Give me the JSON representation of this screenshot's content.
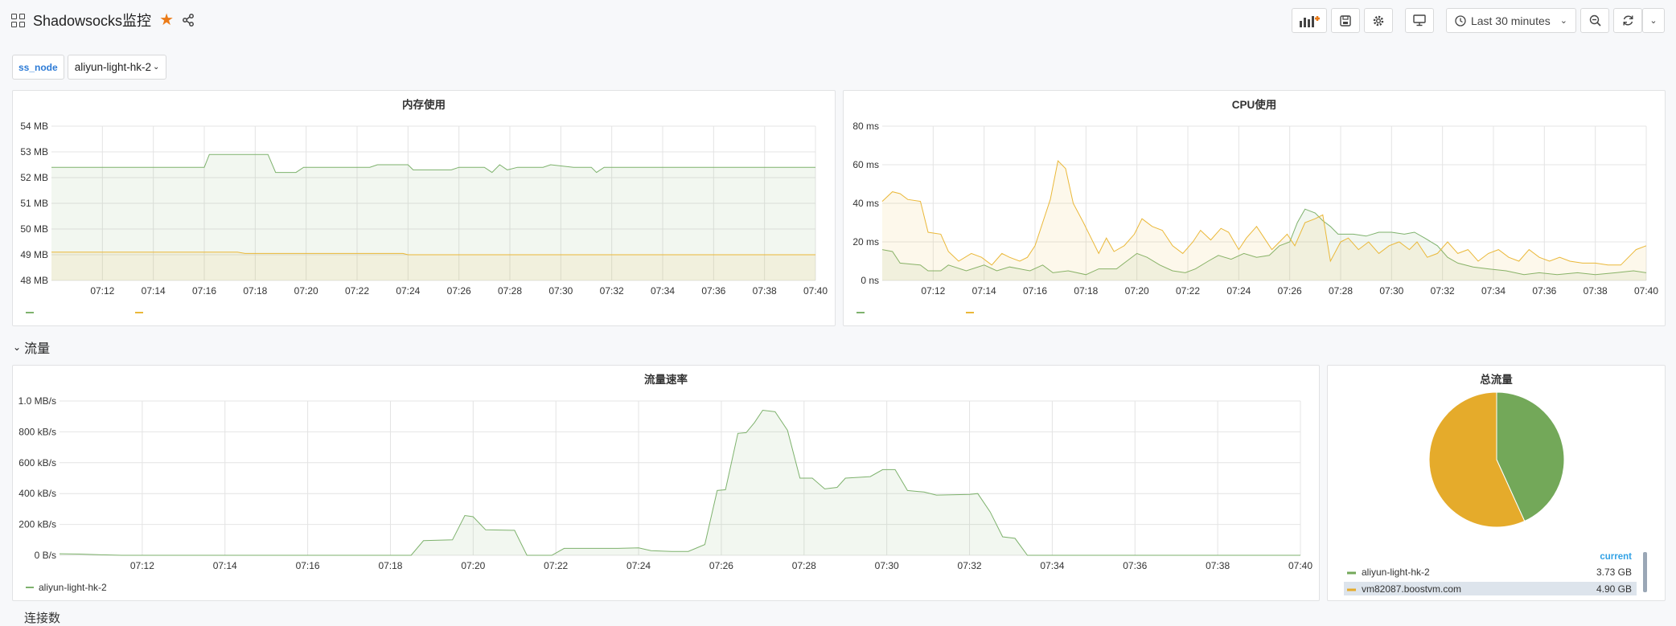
{
  "header": {
    "title": "Shadowsocks监控",
    "time_range": "Last 30 minutes"
  },
  "variables": {
    "label": "ss_node",
    "value": "aliyun-light-hk-2"
  },
  "colors": {
    "green": "#7eb26d",
    "yellow": "#eab839",
    "pie_green": "#73a859",
    "pie_yellow": "#e5ab2b"
  },
  "panels": {
    "memory": {
      "title": "内存使用"
    },
    "cpu": {
      "title": "CPU使用"
    },
    "rate": {
      "title": "流量速率"
    },
    "total": {
      "title": "总流量",
      "current_header": "current"
    }
  },
  "rows": {
    "traffic": "流量",
    "connections": "连接数"
  },
  "chart_data": [
    {
      "type": "area",
      "name": "memory",
      "title": "内存使用",
      "ylim": [
        48,
        54
      ],
      "y_ticks": [
        "48 MB",
        "49 MB",
        "50 MB",
        "51 MB",
        "52 MB",
        "53 MB",
        "54 MB"
      ],
      "x_ticks": [
        "07:12",
        "07:14",
        "07:16",
        "07:18",
        "07:20",
        "07:22",
        "07:24",
        "07:26",
        "07:28",
        "07:30",
        "07:32",
        "07:34",
        "07:36",
        "07:38",
        "07:40"
      ],
      "x_range": [
        10.0,
        40.0
      ],
      "series": [
        {
          "color": "#7eb26d",
          "points": [
            [
              10.0,
              52.4
            ],
            [
              16.0,
              52.4
            ],
            [
              16.2,
              52.9
            ],
            [
              18.5,
              52.9
            ],
            [
              18.8,
              52.2
            ],
            [
              19.6,
              52.2
            ],
            [
              19.9,
              52.4
            ],
            [
              22.5,
              52.4
            ],
            [
              22.8,
              52.5
            ],
            [
              24.0,
              52.5
            ],
            [
              24.2,
              52.3
            ],
            [
              25.7,
              52.3
            ],
            [
              26.0,
              52.4
            ],
            [
              27.0,
              52.4
            ],
            [
              27.3,
              52.2
            ],
            [
              27.6,
              52.5
            ],
            [
              27.9,
              52.3
            ],
            [
              28.3,
              52.4
            ],
            [
              29.3,
              52.4
            ],
            [
              29.6,
              52.5
            ],
            [
              30.5,
              52.4
            ],
            [
              31.2,
              52.4
            ],
            [
              31.4,
              52.2
            ],
            [
              31.7,
              52.4
            ],
            [
              40.0,
              52.4
            ]
          ]
        },
        {
          "color": "#eab839",
          "points": [
            [
              10.0,
              49.1
            ],
            [
              17.3,
              49.1
            ],
            [
              17.6,
              49.05
            ],
            [
              23.8,
              49.05
            ],
            [
              24.0,
              49.0
            ],
            [
              40.0,
              49.0
            ]
          ]
        }
      ]
    },
    {
      "type": "area",
      "name": "cpu",
      "title": "CPU使用",
      "ylim": [
        0,
        80
      ],
      "y_ticks": [
        "0 ns",
        "20 ms",
        "40 ms",
        "60 ms",
        "80 ms"
      ],
      "x_ticks": [
        "07:12",
        "07:14",
        "07:16",
        "07:18",
        "07:20",
        "07:22",
        "07:24",
        "07:26",
        "07:28",
        "07:30",
        "07:32",
        "07:34",
        "07:36",
        "07:38",
        "07:40"
      ],
      "x_range": [
        10.0,
        40.0
      ],
      "series": [
        {
          "color": "#7eb26d",
          "points": [
            [
              10.0,
              16
            ],
            [
              10.4,
              15
            ],
            [
              10.7,
              9
            ],
            [
              11.5,
              8
            ],
            [
              11.8,
              5
            ],
            [
              12.3,
              5
            ],
            [
              12.6,
              8
            ],
            [
              13.3,
              5
            ],
            [
              14.0,
              8
            ],
            [
              14.5,
              5
            ],
            [
              15.0,
              7
            ],
            [
              15.8,
              5
            ],
            [
              16.3,
              8
            ],
            [
              16.7,
              4
            ],
            [
              17.3,
              5
            ],
            [
              18.0,
              3
            ],
            [
              18.5,
              6
            ],
            [
              19.2,
              6
            ],
            [
              19.6,
              10
            ],
            [
              20.0,
              14
            ],
            [
              20.4,
              12
            ],
            [
              20.9,
              8
            ],
            [
              21.4,
              5
            ],
            [
              21.9,
              4
            ],
            [
              22.3,
              6
            ],
            [
              22.8,
              10
            ],
            [
              23.2,
              13
            ],
            [
              23.7,
              11
            ],
            [
              24.2,
              14
            ],
            [
              24.7,
              12
            ],
            [
              25.2,
              13
            ],
            [
              25.6,
              18
            ],
            [
              26.0,
              20
            ],
            [
              26.3,
              30
            ],
            [
              26.6,
              37
            ],
            [
              27.0,
              35
            ],
            [
              27.3,
              31
            ],
            [
              27.6,
              28
            ],
            [
              27.9,
              24
            ],
            [
              28.5,
              24
            ],
            [
              29.0,
              23
            ],
            [
              29.5,
              25
            ],
            [
              30.0,
              25
            ],
            [
              30.5,
              24
            ],
            [
              30.9,
              25
            ],
            [
              31.3,
              22
            ],
            [
              31.8,
              18
            ],
            [
              32.2,
              12
            ],
            [
              32.6,
              9
            ],
            [
              33.2,
              7
            ],
            [
              33.8,
              6
            ],
            [
              34.5,
              5
            ],
            [
              35.2,
              3
            ],
            [
              35.8,
              4
            ],
            [
              36.5,
              3
            ],
            [
              37.3,
              4
            ],
            [
              38.0,
              3
            ],
            [
              38.8,
              4
            ],
            [
              39.5,
              5
            ],
            [
              40.0,
              4
            ]
          ]
        },
        {
          "color": "#eab839",
          "points": [
            [
              10.0,
              41
            ],
            [
              10.4,
              46
            ],
            [
              10.7,
              45
            ],
            [
              11.0,
              42
            ],
            [
              11.5,
              41
            ],
            [
              11.8,
              25
            ],
            [
              12.3,
              24
            ],
            [
              12.6,
              15
            ],
            [
              13.0,
              10
            ],
            [
              13.5,
              14
            ],
            [
              13.9,
              12
            ],
            [
              14.3,
              8
            ],
            [
              14.7,
              14
            ],
            [
              15.0,
              12
            ],
            [
              15.4,
              10
            ],
            [
              15.7,
              12
            ],
            [
              16.0,
              18
            ],
            [
              16.3,
              30
            ],
            [
              16.6,
              42
            ],
            [
              16.9,
              62
            ],
            [
              17.2,
              58
            ],
            [
              17.5,
              40
            ],
            [
              17.9,
              30
            ],
            [
              18.2,
              22
            ],
            [
              18.5,
              14
            ],
            [
              18.8,
              22
            ],
            [
              19.1,
              15
            ],
            [
              19.5,
              18
            ],
            [
              19.9,
              24
            ],
            [
              20.2,
              32
            ],
            [
              20.6,
              28
            ],
            [
              21.0,
              26
            ],
            [
              21.4,
              18
            ],
            [
              21.8,
              14
            ],
            [
              22.2,
              20
            ],
            [
              22.5,
              26
            ],
            [
              22.9,
              21
            ],
            [
              23.3,
              27
            ],
            [
              23.6,
              25
            ],
            [
              24.0,
              16
            ],
            [
              24.3,
              22
            ],
            [
              24.7,
              28
            ],
            [
              25.0,
              22
            ],
            [
              25.3,
              16
            ],
            [
              25.6,
              20
            ],
            [
              25.9,
              24
            ],
            [
              26.2,
              18
            ],
            [
              26.6,
              30
            ],
            [
              27.0,
              32
            ],
            [
              27.3,
              34
            ],
            [
              27.6,
              10
            ],
            [
              28.0,
              20
            ],
            [
              28.3,
              22
            ],
            [
              28.7,
              16
            ],
            [
              29.1,
              20
            ],
            [
              29.5,
              14
            ],
            [
              29.9,
              18
            ],
            [
              30.3,
              20
            ],
            [
              30.7,
              16
            ],
            [
              31.0,
              20
            ],
            [
              31.4,
              12
            ],
            [
              31.8,
              14
            ],
            [
              32.2,
              20
            ],
            [
              32.6,
              14
            ],
            [
              33.0,
              16
            ],
            [
              33.4,
              10
            ],
            [
              33.8,
              14
            ],
            [
              34.2,
              16
            ],
            [
              34.6,
              12
            ],
            [
              35.0,
              10
            ],
            [
              35.4,
              16
            ],
            [
              35.8,
              12
            ],
            [
              36.2,
              10
            ],
            [
              36.6,
              12
            ],
            [
              37.0,
              10
            ],
            [
              37.5,
              9
            ],
            [
              38.0,
              9
            ],
            [
              38.5,
              8
            ],
            [
              39.0,
              8
            ],
            [
              39.3,
              12
            ],
            [
              39.6,
              16
            ],
            [
              40.0,
              18
            ]
          ]
        }
      ]
    },
    {
      "type": "area",
      "name": "traffic_rate",
      "title": "流量速率",
      "ylim": [
        0,
        1000
      ],
      "y_ticks": [
        "0 B/s",
        "200 kB/s",
        "400 kB/s",
        "600 kB/s",
        "800 kB/s",
        "1.0 MB/s"
      ],
      "x_ticks": [
        "07:12",
        "07:14",
        "07:16",
        "07:18",
        "07:20",
        "07:22",
        "07:24",
        "07:26",
        "07:28",
        "07:30",
        "07:32",
        "07:34",
        "07:36",
        "07:38",
        "07:40"
      ],
      "x_range": [
        10.0,
        40.0
      ],
      "legend": [
        "aliyun-light-hk-2"
      ],
      "series": [
        {
          "name": "aliyun-light-hk-2",
          "color": "#7eb26d",
          "points": [
            [
              10.0,
              10
            ],
            [
              10.5,
              8
            ],
            [
              11.0,
              3
            ],
            [
              11.5,
              0
            ],
            [
              18.5,
              0
            ],
            [
              18.8,
              95
            ],
            [
              19.5,
              100
            ],
            [
              19.8,
              258
            ],
            [
              20.0,
              250
            ],
            [
              20.3,
              165
            ],
            [
              21.0,
              162
            ],
            [
              21.3,
              0
            ],
            [
              21.9,
              0
            ],
            [
              22.2,
              45
            ],
            [
              23.5,
              45
            ],
            [
              24.0,
              48
            ],
            [
              24.3,
              30
            ],
            [
              24.8,
              25
            ],
            [
              25.2,
              25
            ],
            [
              25.6,
              70
            ],
            [
              25.9,
              420
            ],
            [
              26.1,
              425
            ],
            [
              26.4,
              790
            ],
            [
              26.6,
              795
            ],
            [
              26.8,
              860
            ],
            [
              27.0,
              940
            ],
            [
              27.3,
              930
            ],
            [
              27.6,
              810
            ],
            [
              27.9,
              500
            ],
            [
              28.2,
              500
            ],
            [
              28.5,
              430
            ],
            [
              28.8,
              440
            ],
            [
              29.0,
              500
            ],
            [
              29.6,
              510
            ],
            [
              29.9,
              555
            ],
            [
              30.2,
              555
            ],
            [
              30.5,
              420
            ],
            [
              30.9,
              410
            ],
            [
              31.2,
              390
            ],
            [
              32.0,
              395
            ],
            [
              32.2,
              400
            ],
            [
              32.5,
              280
            ],
            [
              32.8,
              120
            ],
            [
              33.1,
              110
            ],
            [
              33.4,
              0
            ],
            [
              40.0,
              0
            ]
          ]
        }
      ]
    },
    {
      "type": "pie",
      "name": "total_traffic",
      "title": "总流量",
      "legend_header": "current",
      "slices": [
        {
          "label": "aliyun-light-hk-2",
          "value": 3.73,
          "display": "3.73 GB",
          "color": "#73a859"
        },
        {
          "label": "vm82087.boostvm.com",
          "value": 4.9,
          "display": "4.90 GB",
          "color": "#e5ab2b"
        }
      ]
    }
  ]
}
